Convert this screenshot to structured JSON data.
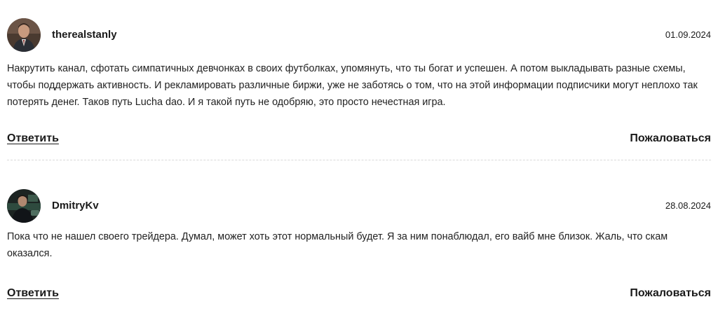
{
  "comments": [
    {
      "username": "therealstanly",
      "date": "01.09.2024",
      "text": "Накрутить канал, сфотать симпатичных девчонках в своих футболках, упомянуть, что ты богат и успешен. А потом выкладывать разные схемы, чтобы поддержать активность. И рекламировать различные биржи, уже не заботясь о том, что на этой информации подписчики могут неплохо так потерять денег. Таков путь Lucha dao. И я такой путь не одобряю, это просто нечестная игра.",
      "reply_label": "Ответить",
      "report_label": "Пожаловаться"
    },
    {
      "username": "DmitryKv",
      "date": "28.08.2024",
      "text": "Пока что не нашел своего трейдера. Думал, может хоть этот нормальный будет. Я за ним понаблюдал, его вайб мне близок. Жаль, что скам оказался.",
      "reply_label": "Ответить",
      "report_label": "Пожаловаться"
    }
  ]
}
